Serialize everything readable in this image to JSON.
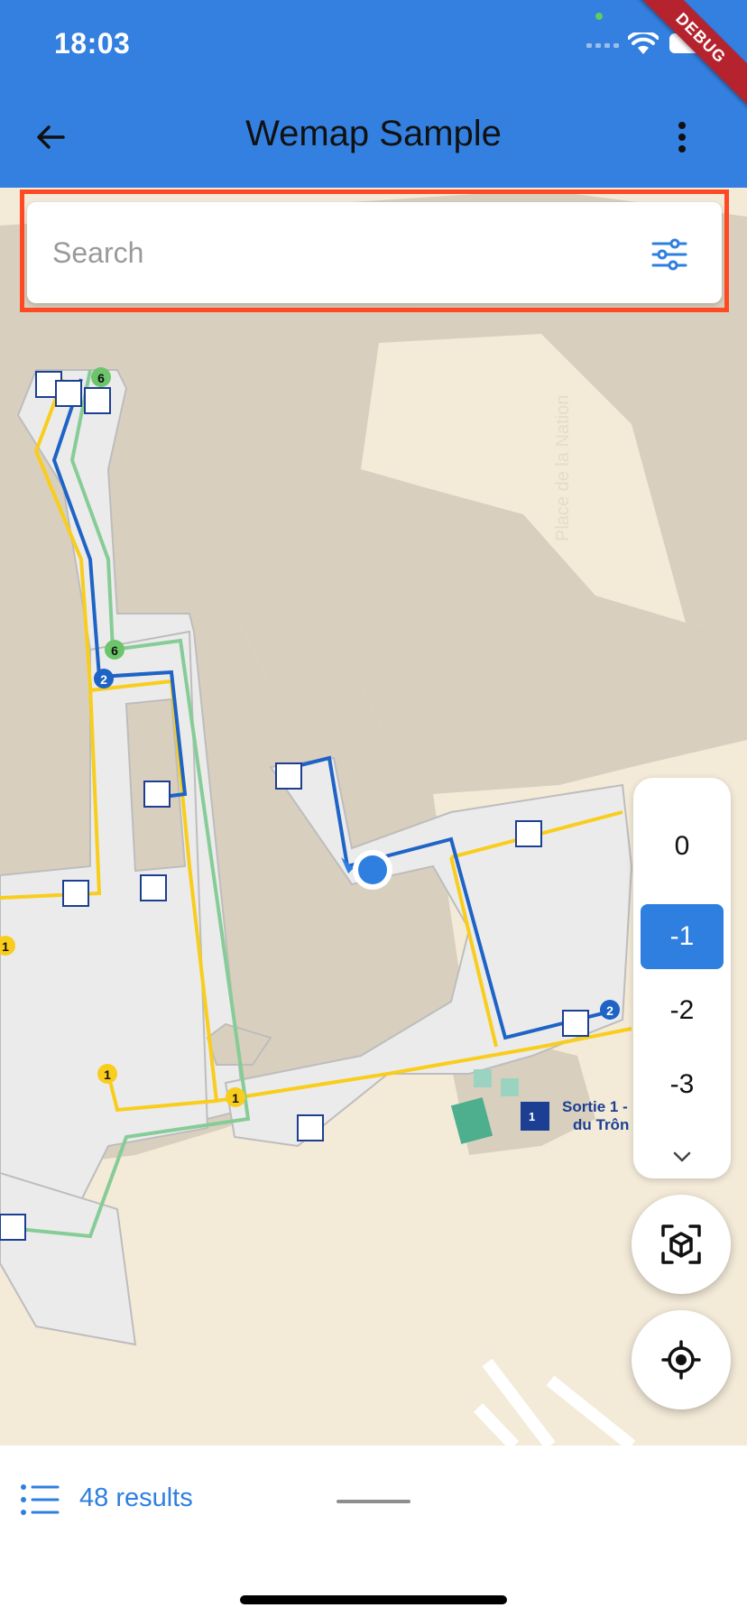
{
  "status_bar": {
    "time": "18:03",
    "debug_label": "DEBUG"
  },
  "app_bar": {
    "title": "Wemap Sample",
    "back_icon": "arrow-back-icon",
    "menu_icon": "more-vert-icon",
    "color": "#3380e0"
  },
  "search": {
    "placeholder": "Search",
    "value": "",
    "filter_icon": "tune-icon"
  },
  "map": {
    "street_label": "Place de la Nation",
    "exit_label_line1": "Sortie 1 -",
    "exit_label_line2": "du Trôn",
    "badges": {
      "line1": "1",
      "line2": "2",
      "line6": "6",
      "exit_sign": "1"
    }
  },
  "floor_selector": {
    "floors": [
      "0",
      "-1",
      "-2",
      "-3"
    ],
    "selected": "-1",
    "more_icon": "chevron-down-icon"
  },
  "buttons": {
    "ar_icon": "cube-scan-icon",
    "locate_icon": "my-location-icon"
  },
  "results": {
    "label": "48 results",
    "icon": "list-icon"
  },
  "colors": {
    "accent": "#2f7fe0",
    "highlight": "#ff4a24",
    "line_yellow": "#f9cd1c",
    "line_blue": "#1e63c6",
    "line_green": "#86cc97"
  }
}
